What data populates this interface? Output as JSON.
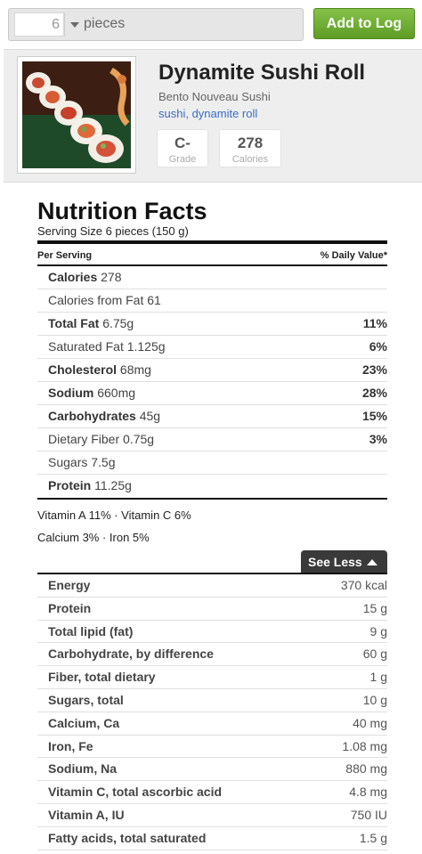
{
  "top": {
    "quantity": "6",
    "unit": "pieces",
    "add_button": "Add to Log"
  },
  "food": {
    "title": "Dynamite Sushi Roll",
    "brand": "Bento Nouveau Sushi",
    "tags": "sushi, dynamite roll",
    "grade": {
      "value": "C-",
      "label": "Grade"
    },
    "calories": {
      "value": "278",
      "label": "Calories"
    }
  },
  "nutrition": {
    "title": "Nutrition Facts",
    "serving": "Serving Size 6 pieces (150 g)",
    "per_serving": "Per Serving",
    "daily_value": "% Daily Value*",
    "rows": [
      {
        "name": "Calories",
        "value": "278",
        "pct": "",
        "bold": true
      },
      {
        "name": "Calories from Fat",
        "value": "61",
        "pct": "",
        "bold": false
      },
      {
        "name": "Total Fat",
        "value": "6.75g",
        "pct": "11%",
        "bold": true
      },
      {
        "name": "Saturated Fat",
        "value": "1.125g",
        "pct": "6%",
        "bold": false
      },
      {
        "name": "Cholesterol",
        "value": "68mg",
        "pct": "23%",
        "bold": true
      },
      {
        "name": "Sodium",
        "value": "660mg",
        "pct": "28%",
        "bold": true
      },
      {
        "name": "Carbohydrates",
        "value": "45g",
        "pct": "15%",
        "bold": true
      },
      {
        "name": "Dietary Fiber",
        "value": "0.75g",
        "pct": "3%",
        "bold": false
      },
      {
        "name": "Sugars",
        "value": "7.5g",
        "pct": "",
        "bold": false
      },
      {
        "name": "Protein",
        "value": "11.25g",
        "pct": "",
        "bold": true
      }
    ],
    "vitamins_line1": "Vitamin A 11% · Vitamin C 6%",
    "vitamins_line2": "Calcium 3% · Iron 5%",
    "see_less": "See Less"
  },
  "details": [
    {
      "name": "Energy",
      "value": "370 kcal"
    },
    {
      "name": "Protein",
      "value": "15 g"
    },
    {
      "name": "Total lipid (fat)",
      "value": "9 g"
    },
    {
      "name": "Carbohydrate, by difference",
      "value": "60 g"
    },
    {
      "name": "Fiber, total dietary",
      "value": "1 g"
    },
    {
      "name": "Sugars, total",
      "value": "10 g"
    },
    {
      "name": "Calcium, Ca",
      "value": "40 mg"
    },
    {
      "name": "Iron, Fe",
      "value": "1.08 mg"
    },
    {
      "name": "Sodium, Na",
      "value": "880 mg"
    },
    {
      "name": "Vitamin C, total ascorbic acid",
      "value": "4.8 mg"
    },
    {
      "name": "Vitamin A, IU",
      "value": "750 IU"
    },
    {
      "name": "Fatty acids, total saturated",
      "value": "1.5 g"
    }
  ]
}
